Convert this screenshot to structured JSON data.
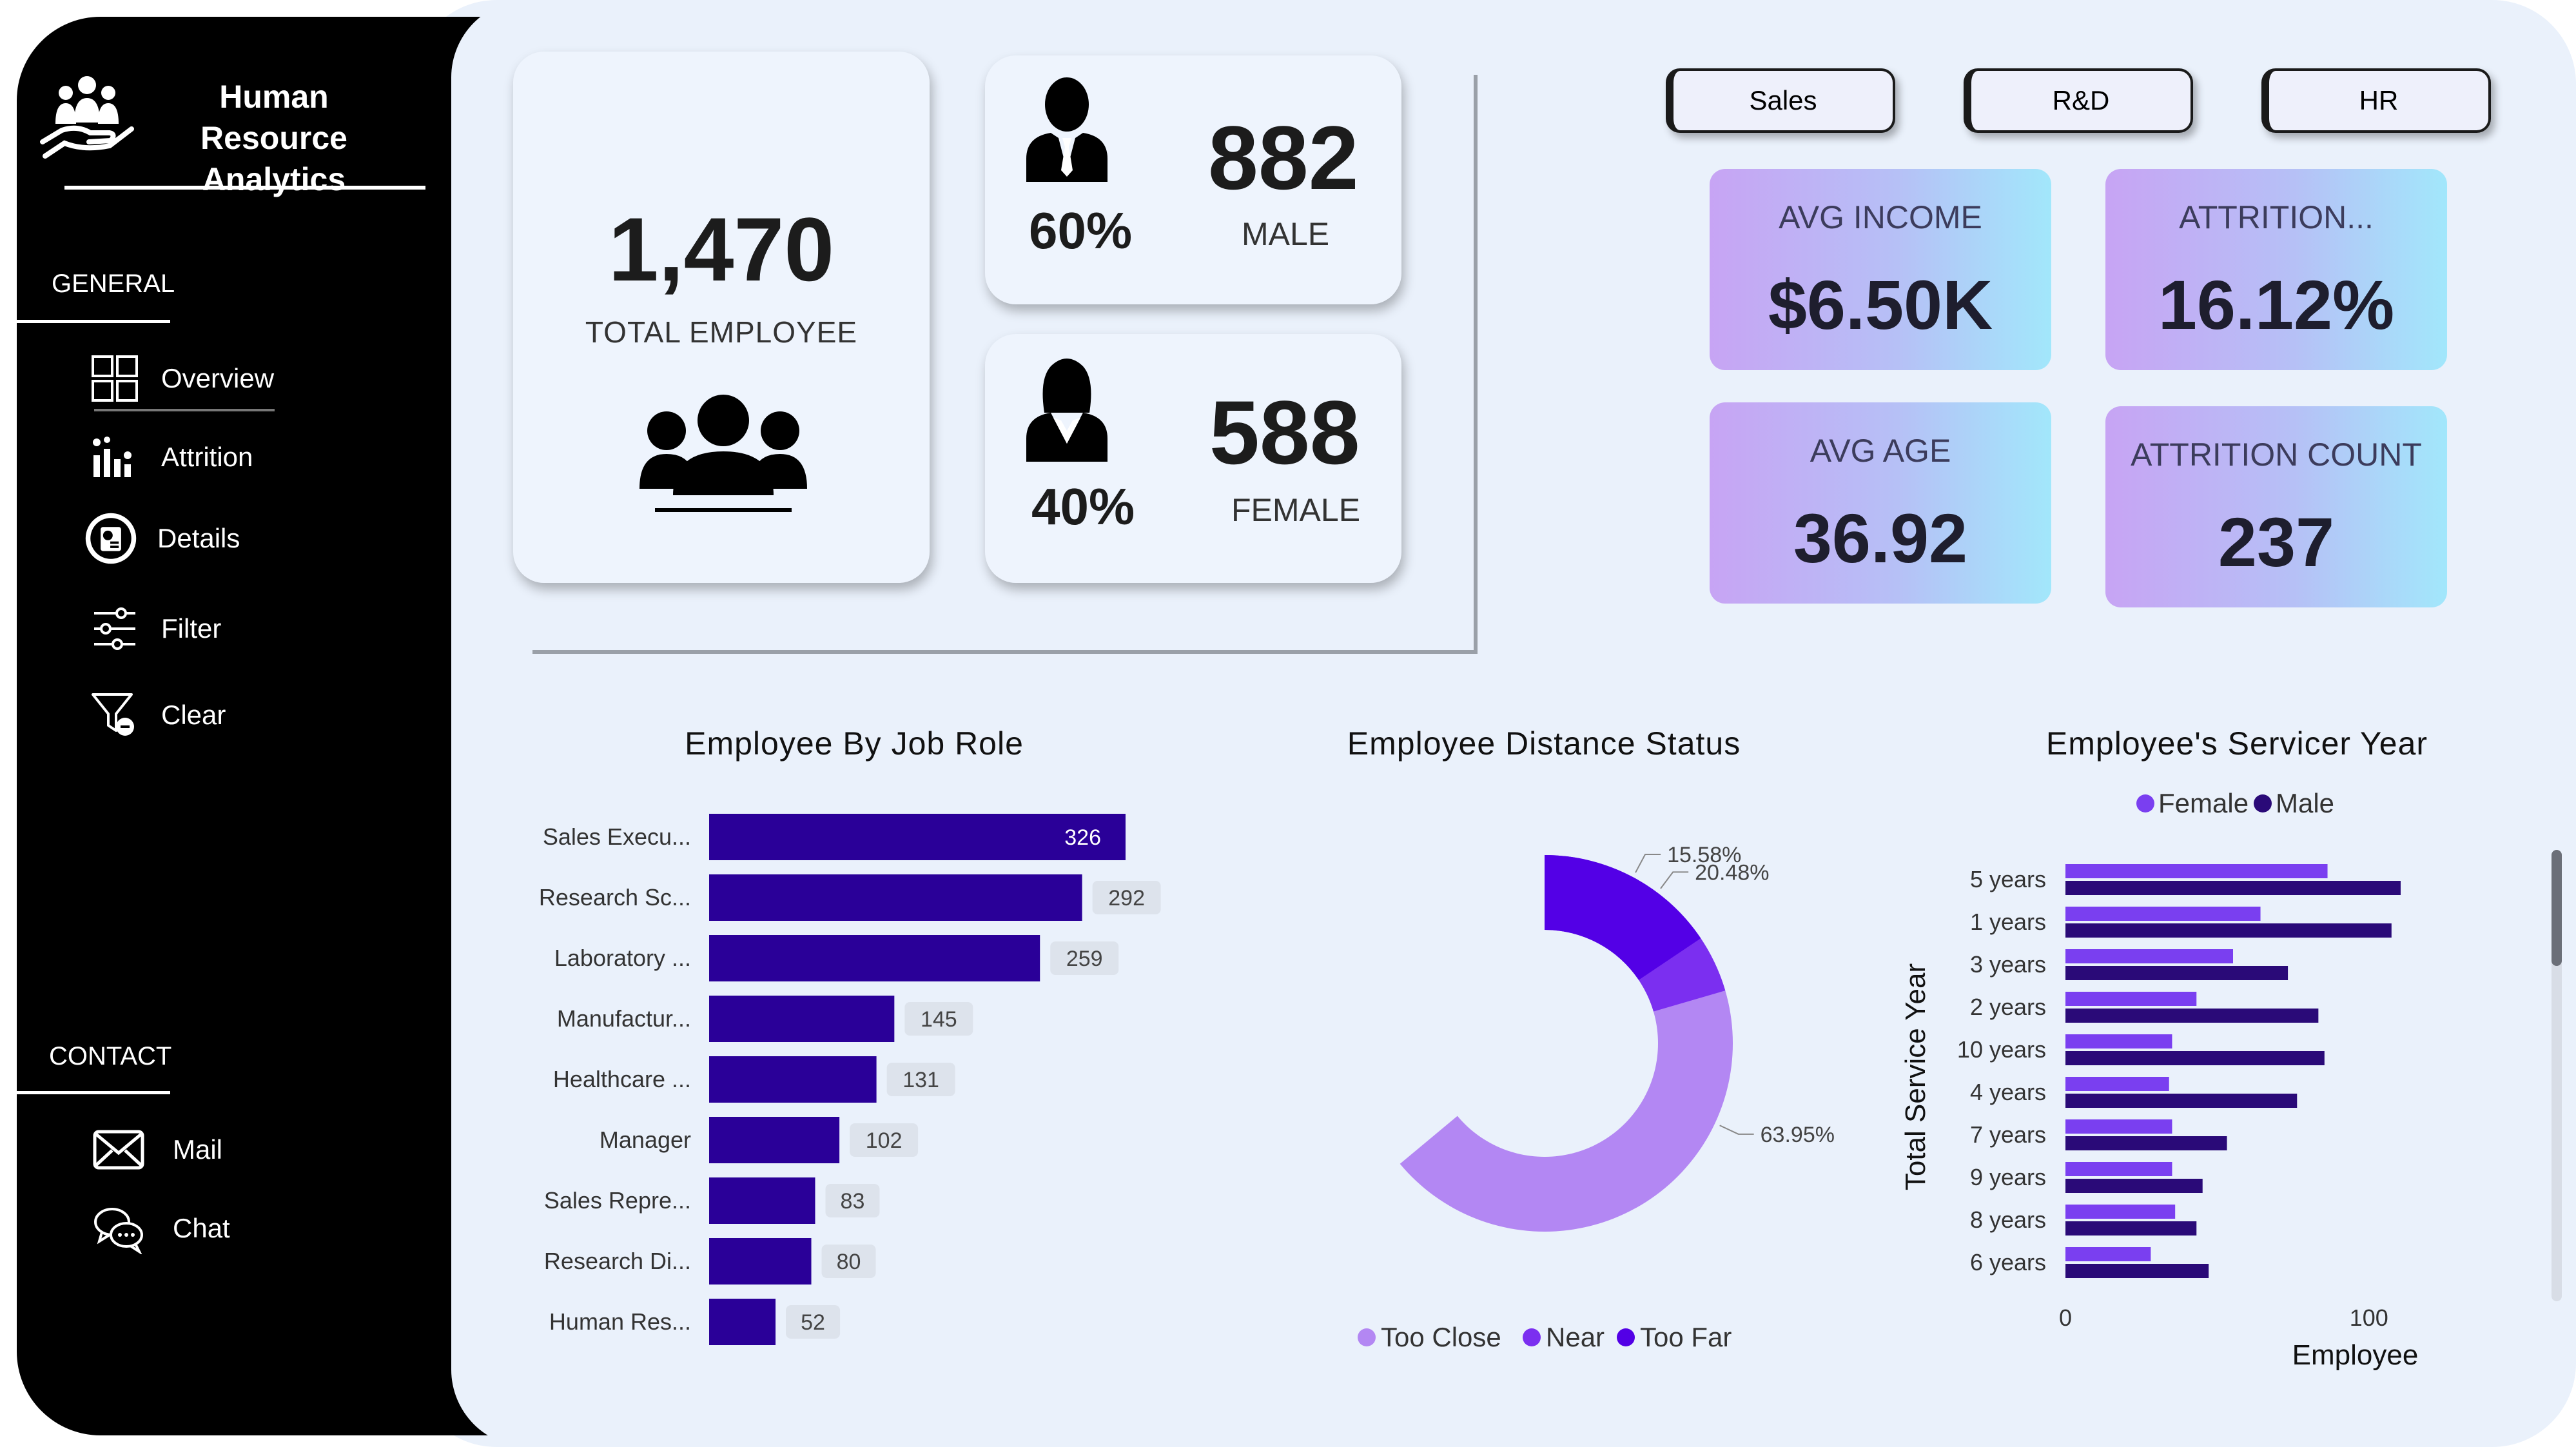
{
  "app": {
    "title": "Human Resource Analytics"
  },
  "sidebar": {
    "general_label": "GENERAL",
    "contact_label": "CONTACT",
    "general_items": [
      {
        "label": "Overview",
        "icon": "grid-icon"
      },
      {
        "label": "Attrition",
        "icon": "attrition-icon"
      },
      {
        "label": "Details",
        "icon": "details-icon"
      },
      {
        "label": "Filter",
        "icon": "sliders-icon"
      },
      {
        "label": "Clear",
        "icon": "clear-filter-icon"
      }
    ],
    "contact_items": [
      {
        "label": "Mail",
        "icon": "mail-icon"
      },
      {
        "label": "Chat",
        "icon": "chat-icon"
      }
    ]
  },
  "summary": {
    "total_value": "1,470",
    "total_label": "TOTAL EMPLOYEE",
    "male_value": "882",
    "male_label": "MALE",
    "male_pct": "60%",
    "female_value": "588",
    "female_label": "FEMALE",
    "female_pct": "40%"
  },
  "departments": [
    "Sales",
    "R&D",
    "HR"
  ],
  "kpis": [
    {
      "label": "AVG INCOME",
      "value": "$6.50K"
    },
    {
      "label": "ATTRITION...",
      "value": "16.12%"
    },
    {
      "label": "AVG AGE",
      "value": "36.92"
    },
    {
      "label": "ATTRITION COUNT",
      "value": "237"
    }
  ],
  "colors": {
    "bar": "#2a0098",
    "too_close": "#b387f3",
    "near": "#7b2ff0",
    "too_far": "#5300e6",
    "female": "#7a3ff0",
    "male": "#2a0a78"
  },
  "chart_data": [
    {
      "type": "bar",
      "orientation": "horizontal",
      "title": "Employee By Job Role",
      "categories": [
        "Sales Execu...",
        "Research Sc...",
        "Laboratory ...",
        "Manufactur...",
        "Healthcare ...",
        "Manager",
        "Sales Repre...",
        "Research Di...",
        "Human Res..."
      ],
      "values": [
        326,
        292,
        259,
        145,
        131,
        102,
        83,
        80,
        52
      ],
      "color": "#2a0098"
    },
    {
      "type": "pie",
      "donut": true,
      "title": "Employee Distance Status",
      "categories": [
        "Too Close",
        "Near",
        "Too Far"
      ],
      "values": [
        63.95,
        20.48,
        15.58
      ],
      "labels": [
        "63.95%",
        "20.48%",
        "15.58%"
      ],
      "colors": [
        "#b387f3",
        "#7b2ff0",
        "#5300e6"
      ],
      "legend": "bottom"
    },
    {
      "type": "bar",
      "orientation": "horizontal",
      "title": "Employee's Servicer Year",
      "xlabel": "Employee",
      "ylabel": "Total Service Year",
      "categories": [
        "5 years",
        "1 years",
        "3 years",
        "2 years",
        "10 years",
        "4 years",
        "7 years",
        "9 years",
        "8 years",
        "6 years"
      ],
      "series": [
        {
          "name": "Female",
          "values": [
            86,
            64,
            55,
            43,
            35,
            34,
            35,
            35,
            36,
            28
          ],
          "color": "#7a3ff0"
        },
        {
          "name": "Male",
          "values": [
            110,
            107,
            73,
            83,
            85,
            76,
            53,
            45,
            43,
            47
          ],
          "color": "#2a0a78"
        }
      ],
      "xticks": [
        "0",
        "100"
      ],
      "xlim": [
        0,
        110
      ],
      "legend": "top"
    }
  ]
}
